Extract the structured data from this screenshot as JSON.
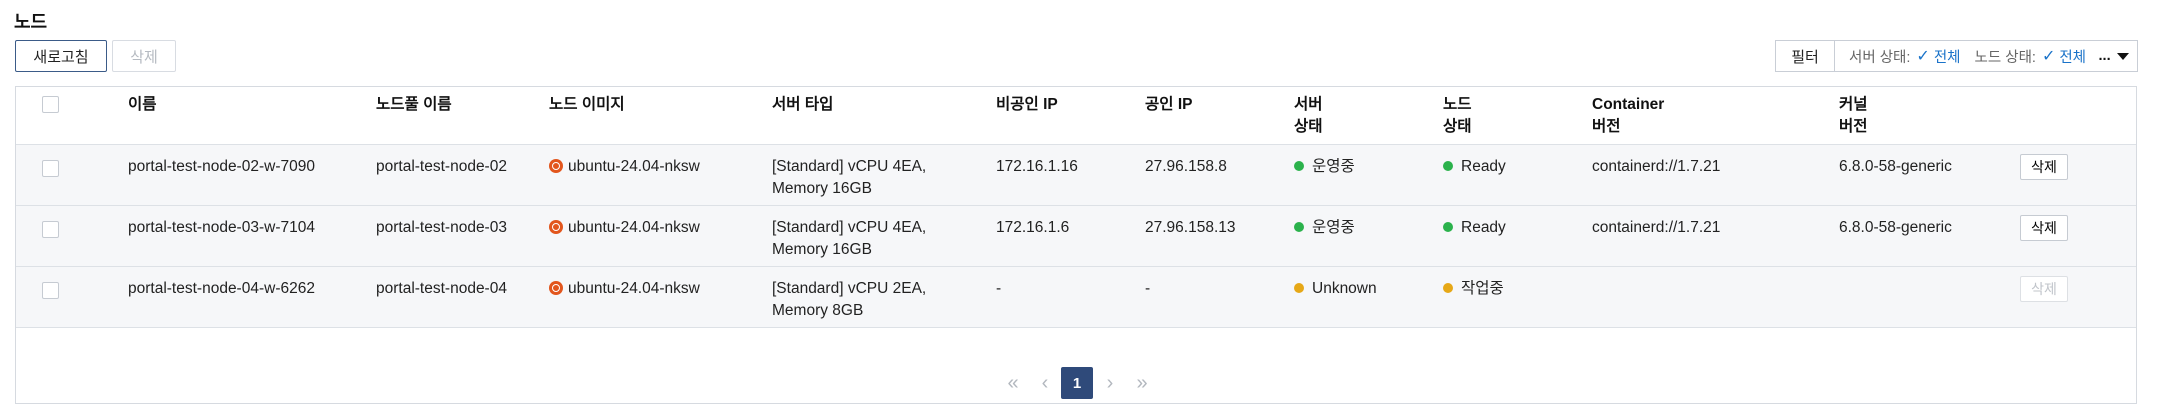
{
  "page": {
    "title": "노드"
  },
  "toolbar": {
    "refresh_label": "새로고침",
    "delete_label": "삭제"
  },
  "filter": {
    "button_label": "필터",
    "server_status_label": "서버 상태:",
    "server_status_value": "전체",
    "node_status_label": "노드 상태:",
    "node_status_value": "전체",
    "more": "..."
  },
  "table": {
    "headers": {
      "name": "이름",
      "nodepool": "노드풀 이름",
      "image": "노드 이미지",
      "server_type": "서버 타입",
      "private_ip": "비공인 IP",
      "public_ip": "공인 IP",
      "server_status_1": "서버",
      "server_status_2": "상태",
      "node_status_1": "노드",
      "node_status_2": "상태",
      "container_1": "Container",
      "container_2": "버전",
      "kernel_1": "커널",
      "kernel_2": "버전"
    },
    "rows": [
      {
        "name": "portal-test-node-02-w-7090",
        "nodepool": "portal-test-node-02",
        "image": "ubuntu-24.04-nksw",
        "server_type_1": "[Standard] vCPU 4EA,",
        "server_type_2": "Memory 16GB",
        "private_ip": "172.16.1.16",
        "public_ip": "27.96.158.8",
        "server_status": "운영중",
        "server_status_color": "#2bb24c",
        "node_status": "Ready",
        "node_status_color": "#2bb24c",
        "container": "containerd://1.7.21",
        "kernel": "6.8.0-58-generic",
        "delete_label": "삭제"
      },
      {
        "name": "portal-test-node-03-w-7104",
        "nodepool": "portal-test-node-03",
        "image": "ubuntu-24.04-nksw",
        "server_type_1": "[Standard] vCPU 4EA,",
        "server_type_2": "Memory 16GB",
        "private_ip": "172.16.1.6",
        "public_ip": "27.96.158.13",
        "server_status": "운영중",
        "server_status_color": "#2bb24c",
        "node_status": "Ready",
        "node_status_color": "#2bb24c",
        "container": "containerd://1.7.21",
        "kernel": "6.8.0-58-generic",
        "delete_label": "삭제"
      },
      {
        "name": "portal-test-node-04-w-6262",
        "nodepool": "portal-test-node-04",
        "image": "ubuntu-24.04-nksw",
        "server_type_1": "[Standard] vCPU 2EA,",
        "server_type_2": "Memory 8GB",
        "private_ip": "-",
        "public_ip": "-",
        "server_status": "Unknown",
        "server_status_color": "#e6a817",
        "node_status": "작업중",
        "node_status_color": "#e6a817",
        "container": "",
        "kernel": "",
        "delete_label": "삭제"
      }
    ]
  },
  "pagination": {
    "current_page": "1",
    "first_icon": "double-chevron-left",
    "prev_icon": "chevron-left",
    "next_icon": "chevron-right",
    "last_icon": "double-chevron-right"
  },
  "colors": {
    "link": "#1a6fc0",
    "accent": "#2f4a7a",
    "ok": "#2bb24c",
    "pending": "#e6a817"
  }
}
